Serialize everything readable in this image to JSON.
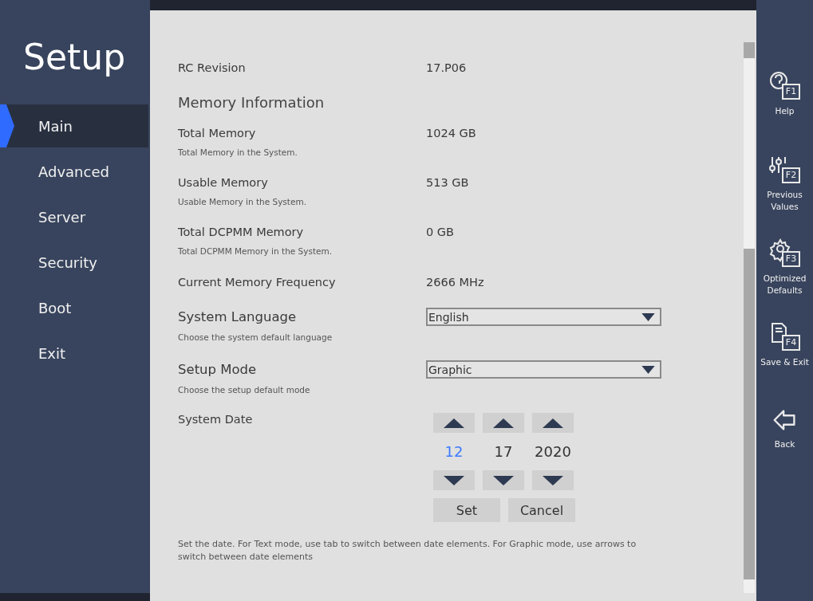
{
  "sidebar": {
    "title": "Setup",
    "items": [
      {
        "label": "Main",
        "selected": true
      },
      {
        "label": "Advanced",
        "selected": false
      },
      {
        "label": "Server",
        "selected": false
      },
      {
        "label": "Security",
        "selected": false
      },
      {
        "label": "Boot",
        "selected": false
      },
      {
        "label": "Exit",
        "selected": false
      }
    ]
  },
  "settings": [
    {
      "kind": "info",
      "label": "RC Revision",
      "value": "17.P06"
    },
    {
      "kind": "heading",
      "label": "Memory Information"
    },
    {
      "kind": "info",
      "label": "Total Memory",
      "value": "1024 GB",
      "description": "Total Memory in the System."
    },
    {
      "kind": "info",
      "label": "Usable Memory",
      "value": "513 GB",
      "description": "Usable Memory in the System."
    },
    {
      "kind": "info",
      "label": "Total DCPMM Memory",
      "value": "0 GB",
      "description": "Total DCPMM Memory in the System."
    },
    {
      "kind": "info",
      "label": "Current Memory Frequency",
      "value": "2666 MHz"
    },
    {
      "kind": "dropdown",
      "label": "System Language",
      "value": "English",
      "description": "Choose the system default language"
    },
    {
      "kind": "dropdown",
      "label": "Setup Mode",
      "value": "Graphic",
      "description": "Choose the setup default mode"
    },
    {
      "kind": "date",
      "label": "System Date",
      "parts": [
        {
          "value": "12",
          "selected": true
        },
        {
          "value": "17",
          "selected": false
        },
        {
          "value": "2020",
          "selected": false
        }
      ],
      "buttons": [
        "Set",
        "Cancel"
      ]
    }
  ],
  "help_text": "Set the date. For Text mode, use tab to switch between date elements. For Graphic mode, use arrows to switch between date elements",
  "function_keys": [
    {
      "kind": "help",
      "key": "F1",
      "label": "Help"
    },
    {
      "kind": "previous",
      "key": "F2",
      "label": "Previous Values"
    },
    {
      "kind": "defaults",
      "key": "F3",
      "label": "Optimized Defaults"
    },
    {
      "kind": "save",
      "key": "F4",
      "label": "Save & Exit"
    },
    {
      "kind": "back",
      "label": "Back"
    }
  ]
}
